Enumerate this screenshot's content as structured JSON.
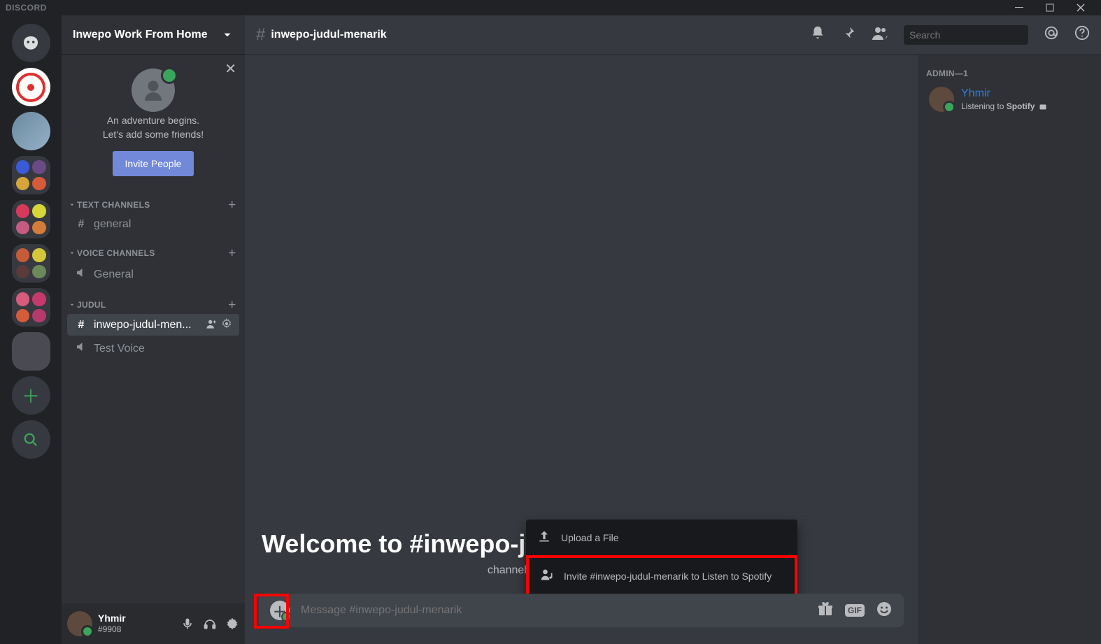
{
  "titlebar": {
    "brand": "DISCORD"
  },
  "server": {
    "name": "Inwepo Work From Home"
  },
  "invite_card": {
    "line1": "An adventure begins.",
    "line2": "Let's add some friends!",
    "button": "Invite People"
  },
  "categories": {
    "text": {
      "label": "TEXT CHANNELS"
    },
    "voice": {
      "label": "VOICE CHANNELS"
    },
    "judul": {
      "label": "JUDUL"
    }
  },
  "channels": {
    "general_text": "general",
    "general_voice": "General",
    "inwepo": "inwepo-judul-men...",
    "test_voice": "Test Voice"
  },
  "user": {
    "name": "Yhmir",
    "tag": "#9908"
  },
  "header": {
    "channel": "inwepo-judul-menarik",
    "search_placeholder": "Search"
  },
  "welcome": {
    "title": "Welcome to #inwepo-judul-menarik!",
    "sub_suffix": "channel."
  },
  "popup": {
    "upload": "Upload a File",
    "invite": "Invite #inwepo-judul-menarik to Listen to Spotify"
  },
  "input": {
    "placeholder": "Message #inwepo-judul-menarik"
  },
  "members": {
    "role": "ADMIN—1",
    "yhmir": {
      "name": "Yhmir",
      "status_prefix": "Listening to ",
      "status_app": "Spotify"
    }
  },
  "gif": "GIF"
}
